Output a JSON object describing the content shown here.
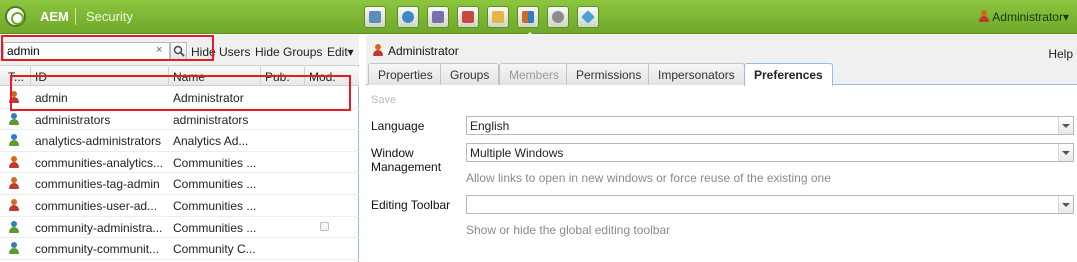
{
  "topbar": {
    "brand": "AEM",
    "section": "Security",
    "app_icons": [
      "websites-icon",
      "digital-assets-icon",
      "mobile-icon",
      "campaigns-icon",
      "inbox-icon",
      "users-icon",
      "tools-icon",
      "tagging-icon"
    ],
    "user_label": "Administrator▾"
  },
  "left": {
    "search_value": "admin",
    "clear_label": "×",
    "hide_users_label": "Hide Users",
    "hide_groups_label": "Hide Groups",
    "edit_label": "Edit▾",
    "columns": {
      "type": "T...",
      "id": "ID",
      "name": "Name",
      "pub": "Pub.",
      "mod": "Mod."
    },
    "rows": [
      {
        "icon": "user-icon",
        "id": "admin",
        "name": "Administrator",
        "mod": false
      },
      {
        "icon": "group-icon",
        "id": "administrators",
        "name": "administrators",
        "mod": false
      },
      {
        "icon": "group-icon",
        "id": "analytics-administrators",
        "name": "Analytics Ad...",
        "mod": false
      },
      {
        "icon": "user-icon",
        "id": "communities-analytics...",
        "name": "Communities ...",
        "mod": false
      },
      {
        "icon": "user-icon",
        "id": "communities-tag-admin",
        "name": "Communities ...",
        "mod": false
      },
      {
        "icon": "user-icon",
        "id": "communities-user-ad...",
        "name": "Communities ...",
        "mod": false
      },
      {
        "icon": "group-icon",
        "id": "community-administra...",
        "name": "Communities ...",
        "mod": true
      },
      {
        "icon": "group-icon",
        "id": "community-communit...",
        "name": "Community C...",
        "mod": false
      }
    ]
  },
  "right": {
    "title": "Administrator",
    "help_label": "Help",
    "tabs": [
      "Properties",
      "Groups",
      "Members",
      "Permissions",
      "Impersonators",
      "Preferences"
    ],
    "active_tab": "Preferences",
    "save_label": "Save",
    "fields": {
      "language": {
        "label": "Language",
        "value": "English"
      },
      "window": {
        "label": "Window Management",
        "value": "Multiple Windows",
        "hint": "Allow links to open in new windows or force reuse of the existing one"
      },
      "toolbar": {
        "label": "Editing Toolbar",
        "value": "",
        "hint": "Show or hide the global editing toolbar"
      }
    }
  },
  "colors": {
    "accent": "#6fa82a",
    "highlight_box": "#e21d23",
    "panel_border": "#99bbe8"
  }
}
